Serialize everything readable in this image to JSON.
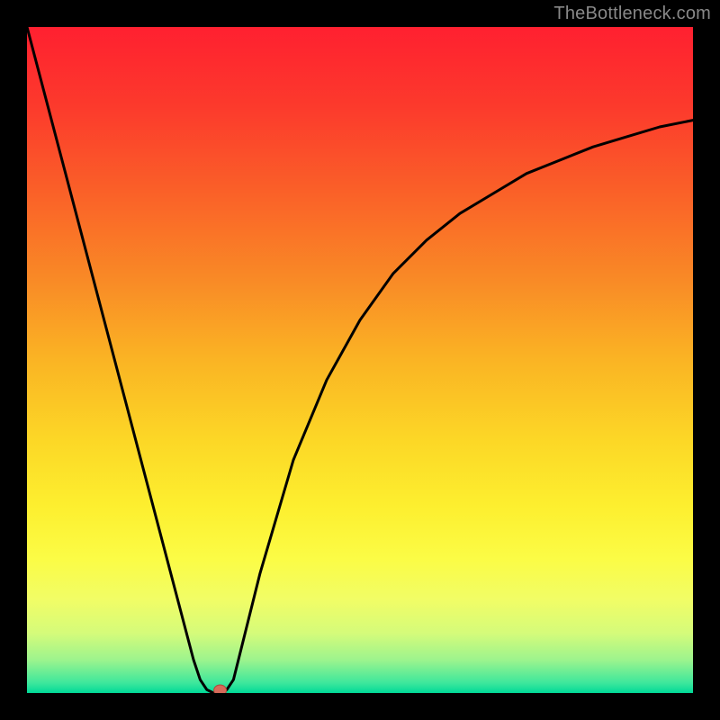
{
  "watermark": "TheBottleneck.com",
  "chart_data": {
    "type": "line",
    "title": "",
    "xlabel": "",
    "ylabel": "",
    "xlim": [
      0,
      100
    ],
    "ylim": [
      0,
      100
    ],
    "x": [
      0,
      5,
      10,
      15,
      20,
      25,
      26,
      27,
      28,
      29,
      30,
      31,
      32,
      35,
      40,
      45,
      50,
      55,
      60,
      65,
      70,
      75,
      80,
      85,
      90,
      95,
      100
    ],
    "values": [
      100,
      81,
      62,
      43,
      24,
      5,
      2,
      0.5,
      0,
      0,
      0.5,
      2,
      6,
      18,
      35,
      47,
      56,
      63,
      68,
      72,
      75,
      78,
      80,
      82,
      83.5,
      85,
      86
    ],
    "marker": {
      "x": 29,
      "y": 0
    },
    "gradient_stops": [
      {
        "pos": 0.0,
        "color": "#ff2030"
      },
      {
        "pos": 0.12,
        "color": "#fc3a2c"
      },
      {
        "pos": 0.25,
        "color": "#fa6128"
      },
      {
        "pos": 0.38,
        "color": "#f98a26"
      },
      {
        "pos": 0.5,
        "color": "#fab424"
      },
      {
        "pos": 0.62,
        "color": "#fcd726"
      },
      {
        "pos": 0.72,
        "color": "#fdef2f"
      },
      {
        "pos": 0.8,
        "color": "#fbfc46"
      },
      {
        "pos": 0.86,
        "color": "#f1fd66"
      },
      {
        "pos": 0.91,
        "color": "#d5fb7a"
      },
      {
        "pos": 0.95,
        "color": "#9df48d"
      },
      {
        "pos": 0.985,
        "color": "#3de79c"
      },
      {
        "pos": 1.0,
        "color": "#00d998"
      }
    ]
  }
}
